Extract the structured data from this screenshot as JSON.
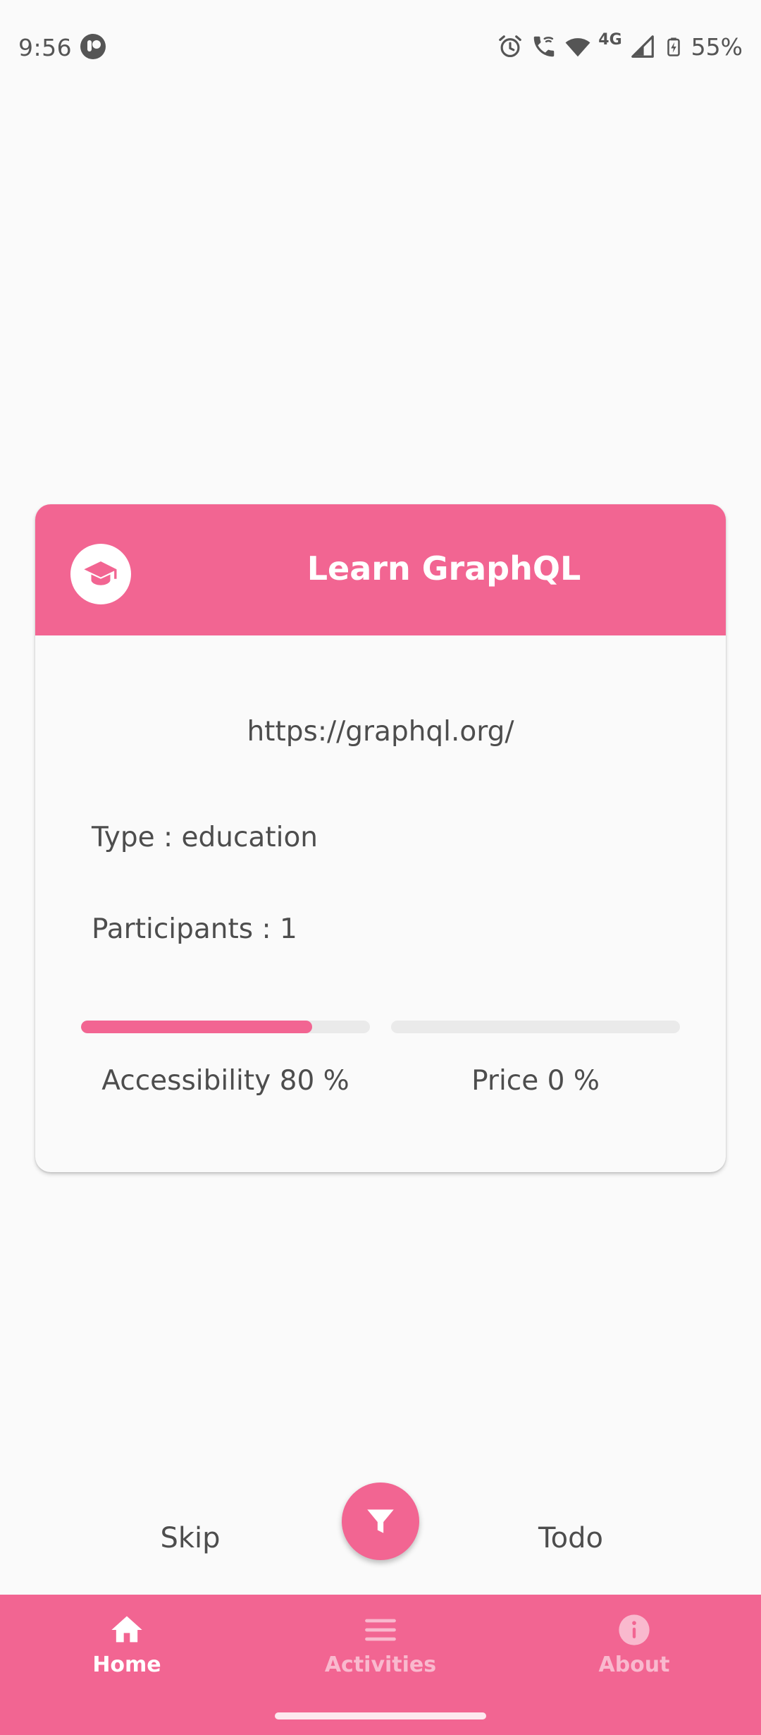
{
  "status_bar": {
    "time": "9:56",
    "network": "4G",
    "battery": "55%",
    "icons": [
      "app-notification-icon",
      "alarm-icon",
      "wifi-calling-icon",
      "wifi-icon",
      "cell-signal-icon",
      "battery-charging-icon"
    ]
  },
  "card": {
    "icon": "graduation-cap-icon",
    "title": "Learn GraphQL",
    "link": "https://graphql.org/",
    "type_text": "Type : education",
    "participants_text": "Participants : 1",
    "accessibility": {
      "label": "Accessibility 80 %",
      "fraction": 0.8
    },
    "price": {
      "label": "Price 0 %",
      "fraction": 0.0
    }
  },
  "actions": {
    "skip_label": "Skip",
    "todo_label": "Todo",
    "filter_icon": "filter-icon"
  },
  "bottom_nav": {
    "items": [
      {
        "label": "Home",
        "icon": "home-icon",
        "active": true
      },
      {
        "label": "Activities",
        "icon": "menu-icon",
        "active": false
      },
      {
        "label": "About",
        "icon": "info-icon",
        "active": false
      }
    ]
  },
  "colors": {
    "accent": "#f26592",
    "background": "#fafafa",
    "text": "#4d4d4d",
    "track": "#eaeaea"
  }
}
